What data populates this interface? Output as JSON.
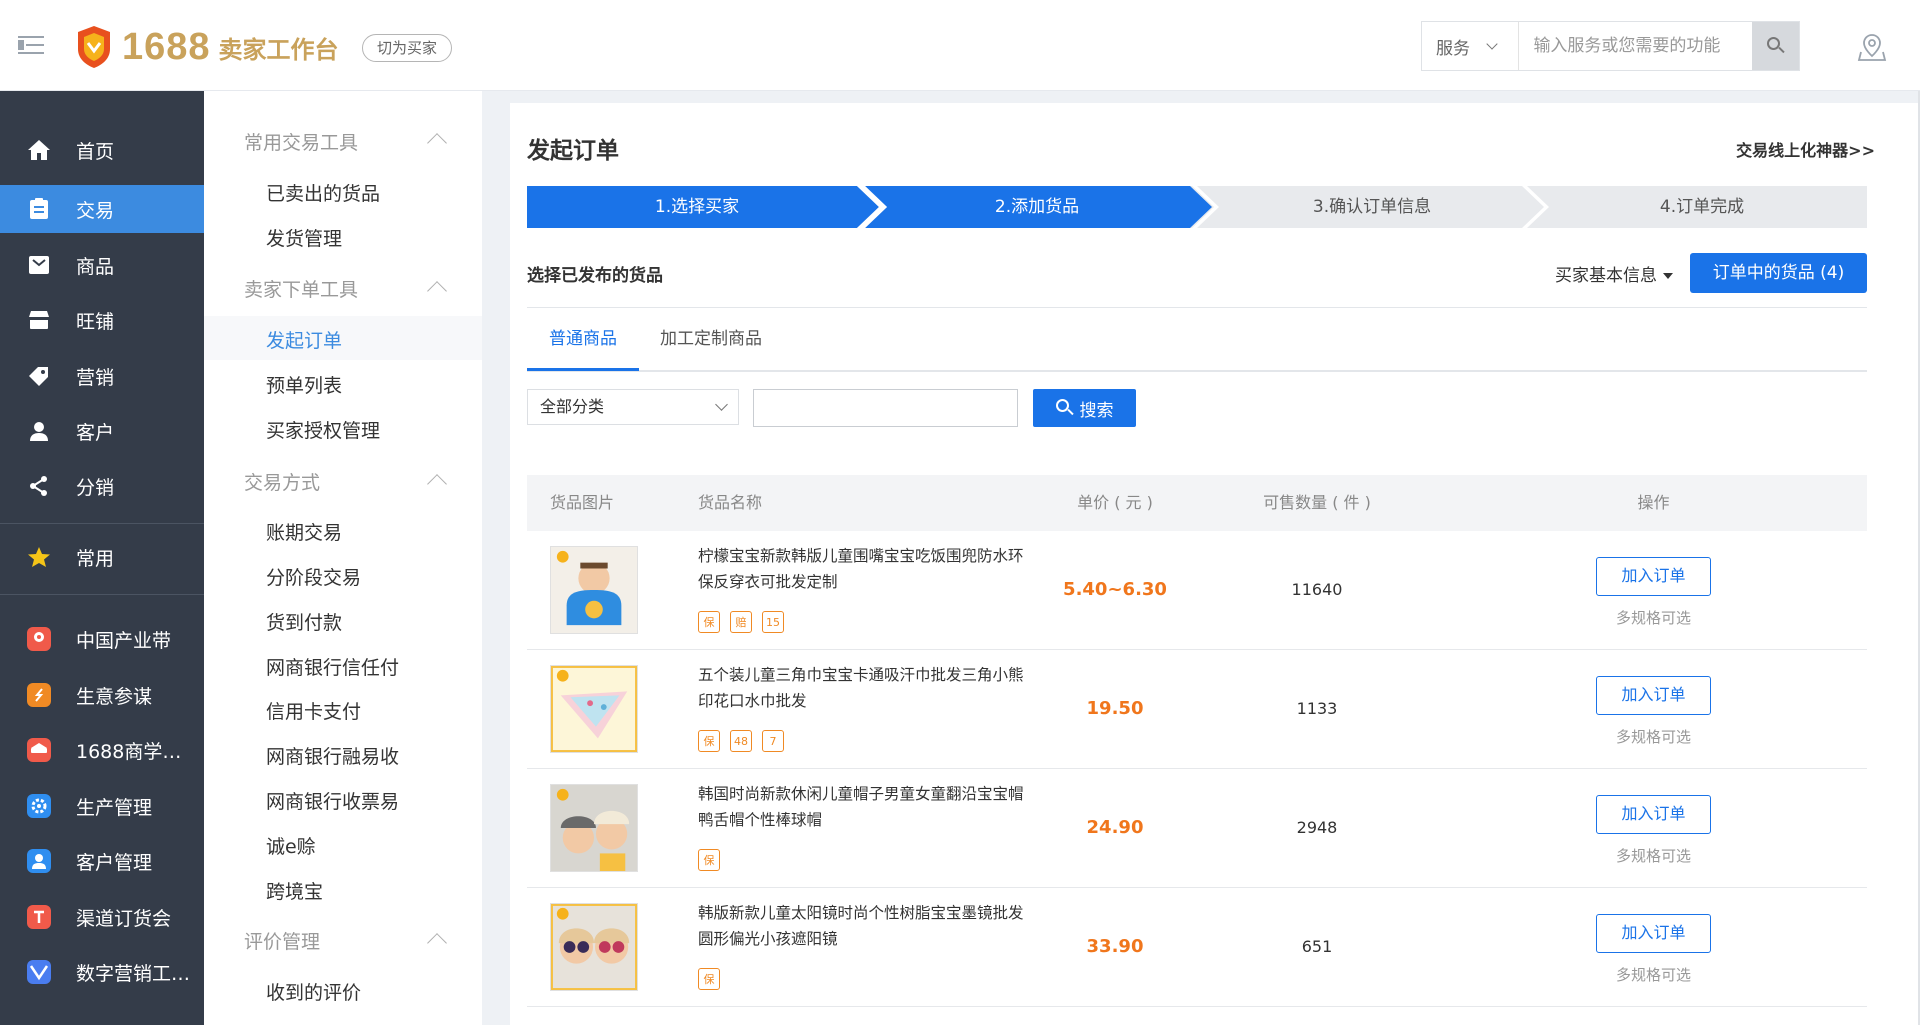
{
  "header": {
    "logo_number": "1688",
    "logo_sub": "卖家工作台",
    "switch_label": "切为买家",
    "search_category": "服务",
    "search_placeholder": "输入服务或您需要的功能",
    "icons": {
      "menu": "hamburger-icon",
      "search": "search-icon",
      "location": "location-pin-icon"
    }
  },
  "leftnav": {
    "items": [
      {
        "label": "首页",
        "icon": "home-icon"
      },
      {
        "label": "交易",
        "icon": "clipboard-icon",
        "active": true
      },
      {
        "label": "商品",
        "icon": "inbox-icon"
      },
      {
        "label": "旺铺",
        "icon": "store-icon"
      },
      {
        "label": "营销",
        "icon": "tag-icon"
      },
      {
        "label": "客户",
        "icon": "user-icon"
      },
      {
        "label": "分销",
        "icon": "share-icon"
      },
      {
        "label": "常用",
        "icon": "star-icon"
      },
      {
        "label": "中国产业带",
        "icon": "map-pin-app-icon",
        "color": "#f05a4a"
      },
      {
        "label": "生意参谋",
        "icon": "compass-app-icon",
        "color": "#f08a24"
      },
      {
        "label": "1688商学…",
        "icon": "school-app-icon",
        "color": "#f05a4a"
      },
      {
        "label": "生产管理",
        "icon": "gear-app-icon",
        "color": "#2f8ef0"
      },
      {
        "label": "客户管理",
        "icon": "person-app-icon",
        "color": "#2f8ef0"
      },
      {
        "label": "渠道订货会",
        "icon": "order-app-icon",
        "color": "#f05a4a"
      },
      {
        "label": "数字营销工…",
        "icon": "marketing-app-icon",
        "color": "#4a7df0"
      }
    ]
  },
  "subnav": {
    "groups": [
      {
        "title": "常用交易工具",
        "items": [
          "已卖出的货品",
          "发货管理"
        ]
      },
      {
        "title": "卖家下单工具",
        "items": [
          "发起订单",
          "预单列表",
          "买家授权管理"
        ]
      },
      {
        "title": "交易方式",
        "items": [
          "账期交易",
          "分阶段交易",
          "货到付款",
          "网商银行信任付",
          "信用卡支付",
          "网商银行融易收",
          "网商银行收票易",
          "诚e赊",
          "跨境宝"
        ]
      },
      {
        "title": "评价管理",
        "items": [
          "收到的评价"
        ]
      }
    ],
    "active_item": "发起订单"
  },
  "main": {
    "title": "发起订单",
    "top_link": "交易线上化神器>>",
    "steps": [
      "1.选择买家",
      "2.添加货品",
      "3.确认订单信息",
      "4.订单完成"
    ],
    "current_step": 2,
    "section_title": "选择已发布的货品",
    "buyer_info": "买家基本信息",
    "order_button": "订单中的货品 (4)",
    "tabs": [
      "普通商品",
      "加工定制商品"
    ],
    "filter_category": "全部分类",
    "search_button": "搜索",
    "columns": [
      "货品图片",
      "货品名称",
      "单价 ( 元 )",
      "可售数量 ( 件 )",
      "操作"
    ],
    "add_label": "加入订单",
    "spec_label": "多规格可选",
    "accent": "#1a73e8",
    "price_color": "#f0761c",
    "rows": [
      {
        "name": "柠檬宝宝新款韩版儿童围嘴宝宝吃饭围兜防水环保反穿衣可批发定制",
        "price": "5.40~6.30",
        "qty": "11640",
        "badges": [
          "保",
          "赔",
          "15"
        ]
      },
      {
        "name": "五个装儿童三角巾宝宝卡通吸汗巾批发三角小熊印花口水巾批发",
        "price": "19.50",
        "qty": "1133",
        "badges": [
          "保",
          "48",
          "7"
        ]
      },
      {
        "name": "韩国时尚新款休闲儿童帽子男童女童翻沿宝宝帽鸭舌帽个性棒球帽",
        "price": "24.90",
        "qty": "2948",
        "badges": [
          "保"
        ]
      },
      {
        "name": "韩版新款儿童太阳镜时尚个性树脂宝宝墨镜批发圆形偏光小孩遮阳镜",
        "price": "33.90",
        "qty": "651",
        "badges": [
          "保"
        ]
      }
    ]
  }
}
